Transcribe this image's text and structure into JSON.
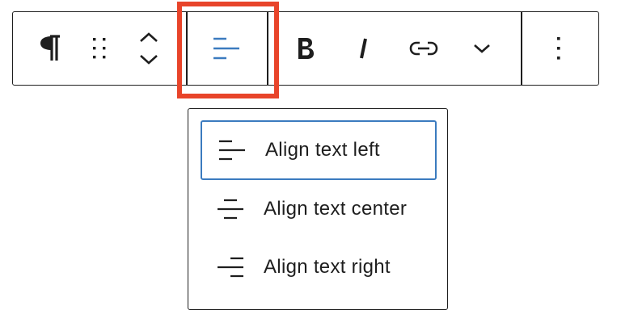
{
  "toolbar": {
    "buttons": [
      {
        "name": "paragraph-block-button",
        "icon": "paragraph-icon"
      },
      {
        "name": "drag-handle-button",
        "icon": "drag-handle-icon"
      },
      {
        "name": "move-up-down-button",
        "icon": "chevron-up-down-icon"
      },
      {
        "name": "align-button",
        "icon": "align-left-icon",
        "state": "open"
      },
      {
        "name": "bold-button",
        "icon": "bold-icon"
      },
      {
        "name": "italic-button",
        "icon": "italic-icon"
      },
      {
        "name": "link-button",
        "icon": "link-icon"
      },
      {
        "name": "more-rich-text-button",
        "icon": "chevron-down-icon"
      },
      {
        "name": "options-button",
        "icon": "vertical-ellipsis-icon"
      }
    ],
    "active_color": "#3b7bbf",
    "highlight_color": "#e8442a"
  },
  "align_menu": {
    "items": [
      {
        "label": "Align text left",
        "icon": "align-left-icon",
        "selected": true
      },
      {
        "label": "Align text center",
        "icon": "align-center-icon",
        "selected": false
      },
      {
        "label": "Align text right",
        "icon": "align-right-icon",
        "selected": false
      }
    ]
  }
}
